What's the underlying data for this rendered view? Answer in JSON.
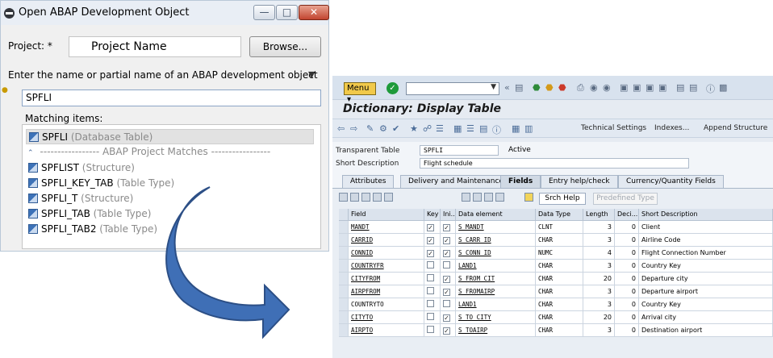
{
  "dialog": {
    "title": "Open ABAP Development Object",
    "project_label": "Project: *",
    "project_value": "Project Name",
    "browse_label": "Browse...",
    "enter_label": "Enter the name or partial name of an ABAP development object",
    "search_value": "SPFLI",
    "matching_label": "Matching items:",
    "items": [
      {
        "name": "SPFLI",
        "kind": "(Database Table)"
      },
      {
        "name": "SPFLIST",
        "kind": "(Structure)"
      },
      {
        "name": "SPFLI_KEY_TAB",
        "kind": "(Table Type)"
      },
      {
        "name": "SPFLI_T",
        "kind": "(Structure)"
      },
      {
        "name": "SPFLI_TAB",
        "kind": "(Table Type)"
      },
      {
        "name": "SPFLI_TAB2",
        "kind": "(Table Type)"
      }
    ],
    "separator_text": "----------------- ABAP Project Matches -----------------"
  },
  "sap": {
    "menu_label": "Menu",
    "title": "Dictionary: Display Table",
    "tech_settings": "Technical Settings",
    "indexes": "Indexes...",
    "append_structure": "Append Structure",
    "transparent_table_label": "Transparent Table",
    "transparent_table_value": "SPFLI",
    "status": "Active",
    "short_desc_label": "Short Description",
    "short_desc_value": "Flight schedule",
    "tabs": [
      "Attributes",
      "Delivery and Maintenance",
      "Fields",
      "Entry help/check",
      "Currency/Quantity Fields"
    ],
    "srch_help": "Srch Help",
    "predefined_type": "Predefined Type",
    "columns": [
      "Field",
      "Key",
      "Ini...",
      "Data element",
      "Data Type",
      "Length",
      "Deci...",
      "Short Description"
    ],
    "rows": [
      {
        "field": "MANDT",
        "key": true,
        "init": true,
        "element": "S_MANDT",
        "type": "CLNT",
        "length": "3",
        "dec": "0",
        "desc": "Client"
      },
      {
        "field": "CARRID",
        "key": true,
        "init": true,
        "element": "S_CARR_ID",
        "type": "CHAR",
        "length": "3",
        "dec": "0",
        "desc": "Airline Code"
      },
      {
        "field": "CONNID",
        "key": true,
        "init": true,
        "element": "S_CONN_ID",
        "type": "NUMC",
        "length": "4",
        "dec": "0",
        "desc": "Flight Connection Number"
      },
      {
        "field": "COUNTRYFR",
        "key": false,
        "init": false,
        "element": "LAND1",
        "type": "CHAR",
        "length": "3",
        "dec": "0",
        "desc": "Country Key"
      },
      {
        "field": "CITYFROM",
        "key": false,
        "init": true,
        "element": "S_FROM_CIT",
        "type": "CHAR",
        "length": "20",
        "dec": "0",
        "desc": "Departure city"
      },
      {
        "field": "AIRPFROM",
        "key": false,
        "init": true,
        "element": "S_FROMAIRP",
        "type": "CHAR",
        "length": "3",
        "dec": "0",
        "desc": "Departure airport"
      },
      {
        "field": "COUNTRYTO",
        "key": false,
        "init": false,
        "element": "LAND1",
        "type": "CHAR",
        "length": "3",
        "dec": "0",
        "desc": "Country Key"
      },
      {
        "field": "CITYTO",
        "key": false,
        "init": true,
        "element": "S_TO_CITY",
        "type": "CHAR",
        "length": "20",
        "dec": "0",
        "desc": "Arrival city"
      },
      {
        "field": "AIRPTO",
        "key": false,
        "init": true,
        "element": "S_TOAIRP",
        "type": "CHAR",
        "length": "3",
        "dec": "0",
        "desc": "Destination airport"
      }
    ]
  }
}
